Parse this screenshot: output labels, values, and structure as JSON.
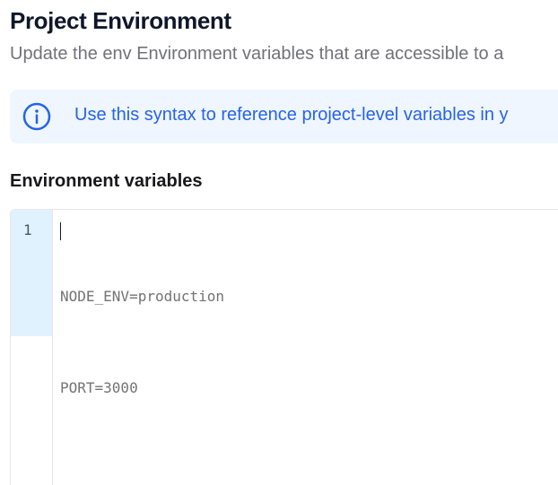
{
  "header": {
    "title": "Project Environment",
    "subtitle": "Update the env Environment variables that are accessible to a"
  },
  "info": {
    "icon": "info-circle-icon",
    "text": "Use this syntax to reference project-level variables in y",
    "color": "#2563eb",
    "background": "#eff6ff"
  },
  "env_section": {
    "label": "Environment variables",
    "editor": {
      "line_numbers": [
        "1"
      ],
      "lines": [
        "NODE_ENV=production",
        "PORT=3000"
      ],
      "placeholder_color": "#737373",
      "active_gutter_color": "#e0f2fe"
    }
  }
}
